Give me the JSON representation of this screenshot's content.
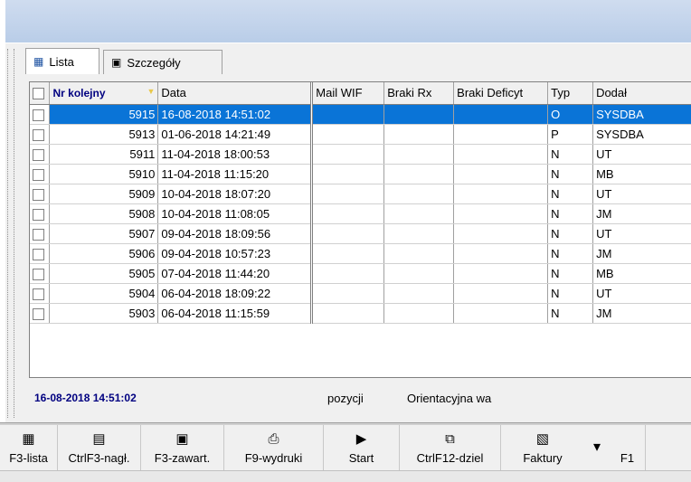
{
  "tabs": [
    {
      "label": "Lista",
      "icon": "list-icon",
      "active": true
    },
    {
      "label": "Szczegóły",
      "icon": "details-icon",
      "active": false
    }
  ],
  "grid": {
    "columns": [
      "Nr kolejny",
      "Data",
      "Mail WIF",
      "Braki Rx",
      "Braki Deficyt",
      "Typ",
      "Dodał"
    ],
    "rows": [
      {
        "nr": "5915",
        "data": "16-08-2018 14:51:02",
        "typ": "O",
        "dodal": "SYSDBA",
        "selected": true
      },
      {
        "nr": "5913",
        "data": "01-06-2018 14:21:49",
        "typ": "P",
        "dodal": "SYSDBA"
      },
      {
        "nr": "5911",
        "data": "11-04-2018 18:00:53",
        "typ": "N",
        "dodal": "UT"
      },
      {
        "nr": "5910",
        "data": "11-04-2018 11:15:20",
        "typ": "N",
        "dodal": "MB"
      },
      {
        "nr": "5909",
        "data": "10-04-2018 18:07:20",
        "typ": "N",
        "dodal": "UT"
      },
      {
        "nr": "5908",
        "data": "10-04-2018 11:08:05",
        "typ": "N",
        "dodal": "JM"
      },
      {
        "nr": "5907",
        "data": "09-04-2018 18:09:56",
        "typ": "N",
        "dodal": "UT"
      },
      {
        "nr": "5906",
        "data": "09-04-2018 10:57:23",
        "typ": "N",
        "dodal": "JM"
      },
      {
        "nr": "5905",
        "data": "07-04-2018 11:44:20",
        "typ": "N",
        "dodal": "MB"
      },
      {
        "nr": "5904",
        "data": "06-04-2018 18:09:22",
        "typ": "N",
        "dodal": "UT"
      },
      {
        "nr": "5903",
        "data": "06-04-2018 11:15:59",
        "typ": "N",
        "dodal": "JM"
      }
    ]
  },
  "status": {
    "date": "16-08-2018 14:51:02",
    "positions": "pozycji",
    "orientation": "Orientacyjna wa"
  },
  "toolbar": [
    {
      "label": "F3-lista",
      "icon": "grid-icon",
      "glyph": "▦"
    },
    {
      "label": "CtrlF3-nagł.",
      "icon": "header-doc-icon",
      "glyph": "▤"
    },
    {
      "label": "F3-zawart.",
      "icon": "form-icon",
      "glyph": "▣"
    },
    {
      "label": "F9-wydruki",
      "icon": "printer-icon",
      "glyph": "⎙"
    },
    {
      "label": "Start",
      "icon": "play-icon",
      "glyph": "▶"
    },
    {
      "label": "CtrlF12-dziel",
      "icon": "split-icon",
      "glyph": "⧉"
    },
    {
      "label": "Faktury",
      "icon": "invoice-icon",
      "glyph": "▧"
    },
    {
      "label": "",
      "icon": "dropdown-arrow-icon",
      "glyph": "▾"
    },
    {
      "label": "F1",
      "icon": "",
      "glyph": ""
    }
  ]
}
